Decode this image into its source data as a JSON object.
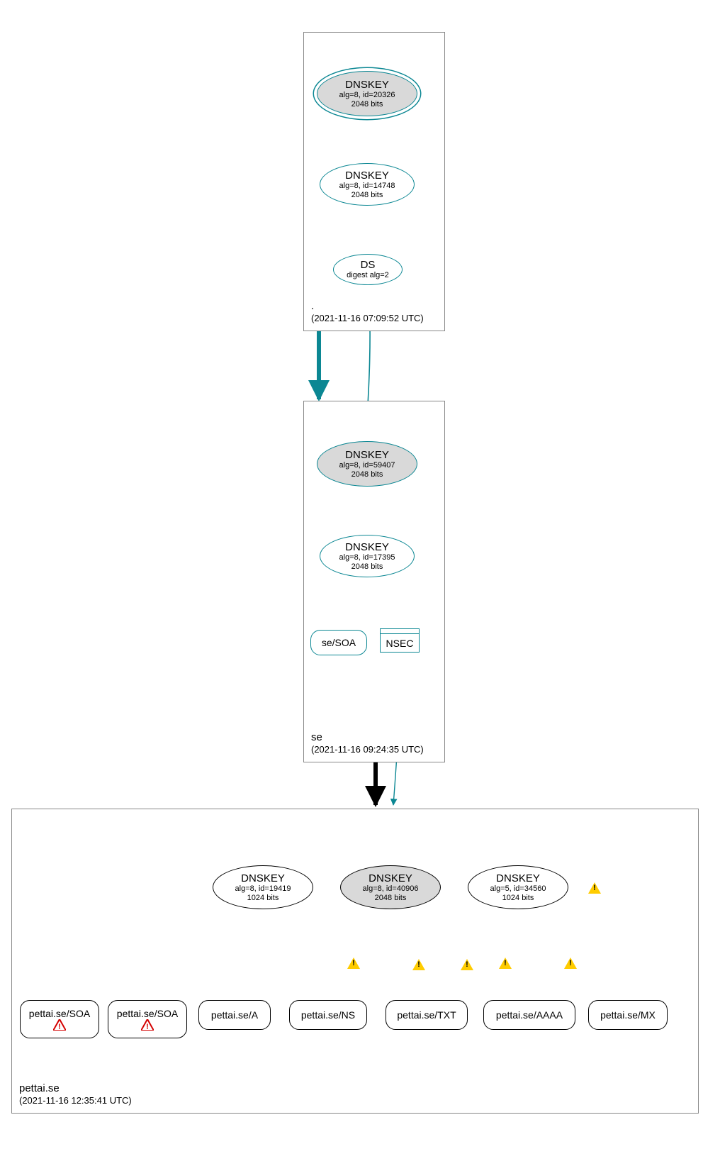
{
  "zones": {
    "root": {
      "name": ".",
      "timestamp": "(2021-11-16 07:09:52 UTC)"
    },
    "se": {
      "name": "se",
      "timestamp": "(2021-11-16 09:24:35 UTC)"
    },
    "pettai": {
      "name": "pettai.se",
      "timestamp": "(2021-11-16 12:35:41 UTC)"
    }
  },
  "nodes": {
    "root_ksk": {
      "title": "DNSKEY",
      "line1": "alg=8, id=20326",
      "line2": "2048 bits"
    },
    "root_zsk": {
      "title": "DNSKEY",
      "line1": "alg=8, id=14748",
      "line2": "2048 bits"
    },
    "root_ds": {
      "title": "DS",
      "line1": "digest alg=2"
    },
    "se_ksk": {
      "title": "DNSKEY",
      "line1": "alg=8, id=59407",
      "line2": "2048 bits"
    },
    "se_zsk": {
      "title": "DNSKEY",
      "line1": "alg=8, id=17395",
      "line2": "2048 bits"
    },
    "se_soa": {
      "label": "se/SOA"
    },
    "se_nsec": {
      "label": "NSEC"
    },
    "p_k1": {
      "title": "DNSKEY",
      "line1": "alg=8, id=19419",
      "line2": "1024 bits"
    },
    "p_k2": {
      "title": "DNSKEY",
      "line1": "alg=8, id=40906",
      "line2": "2048 bits"
    },
    "p_k3": {
      "title": "DNSKEY",
      "line1": "alg=5, id=34560",
      "line2": "1024 bits"
    },
    "p_soa1": {
      "label": "pettai.se/SOA"
    },
    "p_soa2": {
      "label": "pettai.se/SOA"
    },
    "p_a": {
      "label": "pettai.se/A"
    },
    "p_ns": {
      "label": "pettai.se/NS"
    },
    "p_txt": {
      "label": "pettai.se/TXT"
    },
    "p_aaaa": {
      "label": "pettai.se/AAAA"
    },
    "p_mx": {
      "label": "pettai.se/MX"
    }
  }
}
